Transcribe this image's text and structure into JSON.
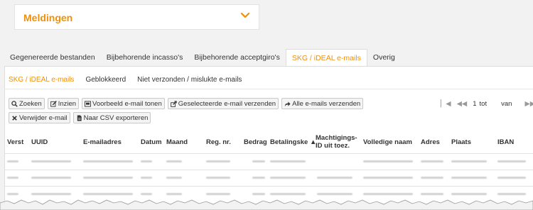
{
  "notifications": {
    "title": "Meldingen"
  },
  "tabs": [
    {
      "label": "Gegenereerde bestanden",
      "active": false
    },
    {
      "label": "Bijbehorende incasso's",
      "active": false
    },
    {
      "label": "Bijbehorende acceptgiro's",
      "active": false
    },
    {
      "label": "SKG / iDEAL e-mails",
      "active": true
    },
    {
      "label": "Overig",
      "active": false
    }
  ],
  "subtabs": [
    {
      "label": "SKG / iDEAL e-mails",
      "active": true
    },
    {
      "label": "Geblokkeerd",
      "active": false
    },
    {
      "label": "Niet verzonden / mislukte e-mails",
      "active": false
    }
  ],
  "toolbar": {
    "search": "Zoeken",
    "view": "Inzien",
    "preview": "Voorbeeld e-mail tonen",
    "send_selected": "Geselecteerde e-mail verzenden",
    "send_all": "Alle e-mails verzenden",
    "delete": "Verwijder e-mail",
    "export": "Naar CSV exporteren"
  },
  "pager": {
    "page": "1",
    "to_label": "tot",
    "of_label": "van"
  },
  "table": {
    "columns": [
      "Verst",
      "UUID",
      "E-mailadres",
      "Datum",
      "Maand",
      "Reg. nr.",
      "Bedrag",
      "Betalingske ▲",
      "Machtigings-ID uit toez.",
      "Volledige naam",
      "Adres",
      "Plaats",
      "IBAN"
    ]
  },
  "colors": {
    "accent": "#f0900a",
    "background": "#f2f2f2",
    "panel": "#ffffff"
  }
}
